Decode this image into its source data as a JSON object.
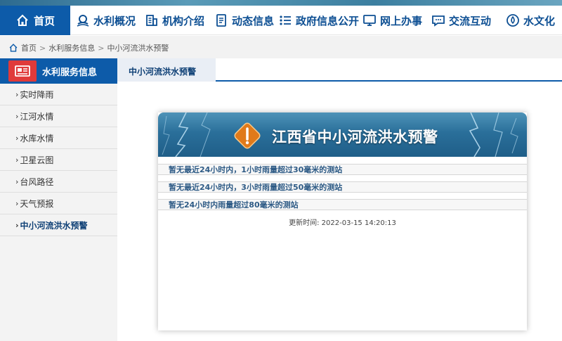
{
  "nav": {
    "home": {
      "label": "首页",
      "icon": "home-icon"
    },
    "items": [
      {
        "label": "水利概况",
        "icon": "water-network-icon"
      },
      {
        "label": "机构介绍",
        "icon": "building-icon"
      },
      {
        "label": "动态信息",
        "icon": "document-icon"
      },
      {
        "label": "政府信息公开",
        "icon": "rows-icon"
      },
      {
        "label": "网上办事",
        "icon": "monitor-icon"
      },
      {
        "label": "交流互动",
        "icon": "chat-icon"
      },
      {
        "label": "水文化",
        "icon": "water-drop-icon"
      }
    ],
    "colors": {
      "primary": "#0d5ba9",
      "text": "#0d4f93"
    }
  },
  "breadcrumb": {
    "items": [
      "首页",
      "水利服务信息",
      "中小河流洪水预警"
    ],
    "separator": ">"
  },
  "sidebar": {
    "title": "水利服务信息",
    "items": [
      {
        "label": "实时降雨"
      },
      {
        "label": "江河水情"
      },
      {
        "label": "水库水情"
      },
      {
        "label": "卫星云图"
      },
      {
        "label": "台风路径"
      },
      {
        "label": "天气预报"
      },
      {
        "label": "中小河流洪水预警"
      }
    ],
    "active_index": 6
  },
  "content": {
    "title": "中小河流洪水预警"
  },
  "panel": {
    "banner_title": "江西省中小河流洪水预警",
    "rows": [
      "暂无最近24小时内，1小时雨量超过30毫米的测站",
      "暂无最近24小时内，3小时雨量超过50毫米的测站",
      "暂无24小时内雨量超过80毫米的测站"
    ],
    "updated_label": "更新时间:",
    "updated_time": "2022-03-15 14:20:13",
    "colors": {
      "banner": "#2a6f9a",
      "warning": "#e07a1a",
      "row_text": "#2d5a85"
    }
  }
}
